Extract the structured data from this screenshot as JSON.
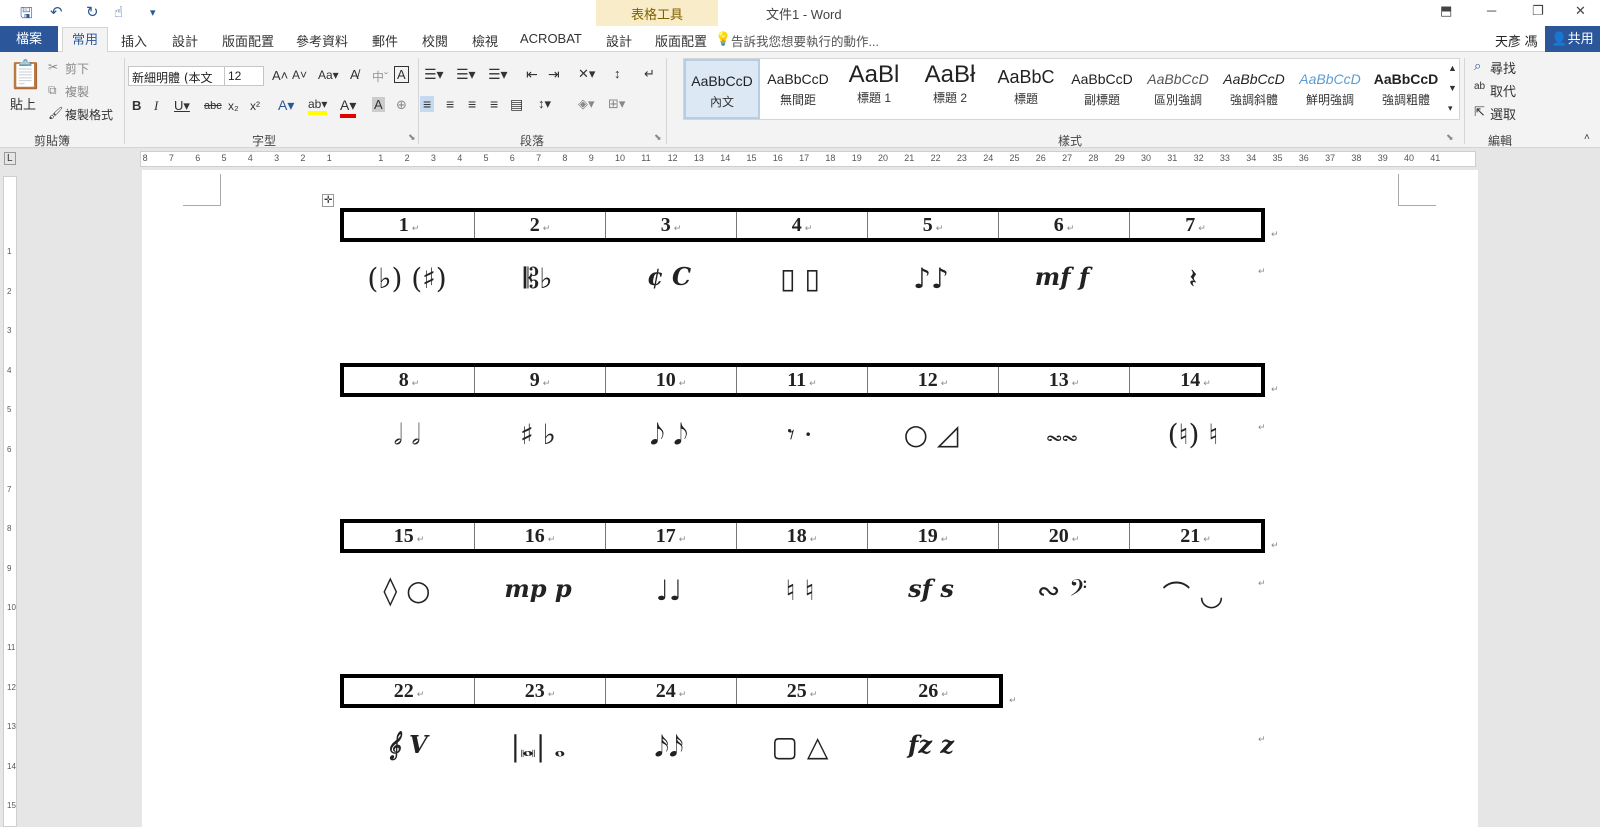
{
  "title_bar": {
    "context_tools": "表格工具",
    "doc_title": "文件1 - Word"
  },
  "tabs": {
    "file": "檔案",
    "home": "常用",
    "items": [
      "插入",
      "設計",
      "版面配置",
      "參考資料",
      "郵件",
      "校閱",
      "檢視",
      "ACROBAT",
      "設計",
      "版面配置"
    ],
    "tell_me": "告訴我您想要執行的動作...",
    "user": "天彥 馮",
    "share": "共用"
  },
  "ribbon": {
    "clipboard": {
      "paste": "貼上",
      "cut": "剪下",
      "copy": "複製",
      "format_painter": "複製格式",
      "label": "剪貼簿"
    },
    "font": {
      "name": "新細明體 (本文",
      "size": "12",
      "label": "字型"
    },
    "paragraph": {
      "label": "段落"
    },
    "styles": {
      "label": "樣式",
      "items": [
        {
          "sample": "AaBbCcD",
          "name": "內文"
        },
        {
          "sample": "AaBbCcD",
          "name": "無間距"
        },
        {
          "sample": "AaBl",
          "name": "標題 1"
        },
        {
          "sample": "AaBł",
          "name": "標題 2"
        },
        {
          "sample": "AaBbC",
          "name": "標題"
        },
        {
          "sample": "AaBbCcD",
          "name": "副標題"
        },
        {
          "sample": "AaBbCcD",
          "name": "區別強調"
        },
        {
          "sample": "AaBbCcD",
          "name": "強調斜體"
        },
        {
          "sample": "AaBbCcD",
          "name": "鮮明強調"
        },
        {
          "sample": "AaBbCcD",
          "name": "強調粗體"
        }
      ]
    },
    "editing": {
      "find": "尋找",
      "replace": "取代",
      "select": "選取",
      "label": "編輯"
    }
  },
  "ruler": {
    "left_ticks": [
      "8",
      "7",
      "6",
      "5",
      "4",
      "3",
      "2",
      "1"
    ],
    "right_ticks": [
      "1",
      "2",
      "3",
      "4",
      "5",
      "6",
      "7",
      "8",
      "9",
      "10",
      "11",
      "12",
      "13",
      "14",
      "15",
      "16",
      "17",
      "18",
      "19",
      "20",
      "21",
      "22",
      "23",
      "24",
      "25",
      "26",
      "27",
      "28",
      "29",
      "30",
      "31",
      "32",
      "33",
      "34",
      "35",
      "36",
      "37",
      "38",
      "39",
      "40",
      "41"
    ]
  },
  "document": {
    "rows": [
      {
        "numbers": [
          "1",
          "2",
          "3",
          "4",
          "5",
          "6",
          "7"
        ],
        "symbols": [
          "(♭) (♯)",
          "𝄡♭",
          "¢ C",
          "▯ ▯",
          "♪♪",
          "mf f",
          "𝄽"
        ]
      },
      {
        "numbers": [
          "8",
          "9",
          "10",
          "11",
          "12",
          "13",
          "14"
        ],
        "symbols": [
          "𝅗𝅥 𝅗𝅥",
          "♯ ♭",
          "𝅘𝅥𝅮 𝅘𝅥𝅮",
          "𝄾 ·",
          "○ ◿",
          "𝆗𝆗",
          "(♮) ♮"
        ]
      },
      {
        "numbers": [
          "15",
          "16",
          "17",
          "18",
          "19",
          "20",
          "21"
        ],
        "symbols": [
          "◊ ○",
          "mp p",
          "♩♩",
          "♮ ♮",
          "sf s",
          "∾ 𝄢",
          "⌒ ◡"
        ]
      },
      {
        "numbers": [
          "22",
          "23",
          "24",
          "25",
          "26"
        ],
        "symbols": [
          "𝄞 V",
          "|𝅜| 𝅝",
          "𝅘𝅥𝅯𝅘𝅥𝅯",
          "▢ △",
          "fz z"
        ]
      }
    ]
  }
}
